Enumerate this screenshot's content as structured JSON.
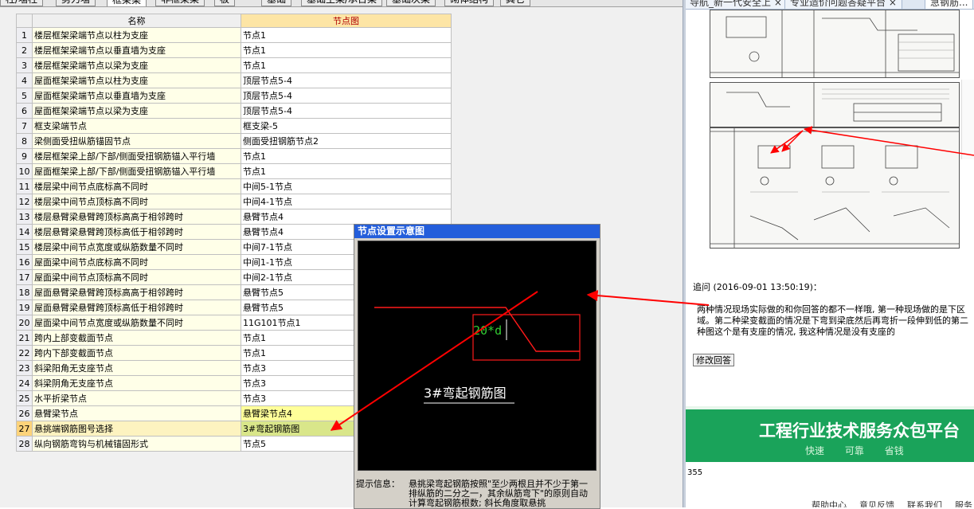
{
  "app": {
    "tabs": [
      "柱/墙柱",
      "剪力墙",
      "框架梁",
      "非框架梁",
      "板",
      "基础",
      "基础主梁/承台梁",
      "基础次梁",
      "砌体结构",
      "其它"
    ],
    "active_tab": 2,
    "table": {
      "headers": [
        "名称",
        "节点图"
      ],
      "rows": [
        {
          "num": "1",
          "name": "楼层框架梁端节点以柱为支座",
          "node": "节点1"
        },
        {
          "num": "2",
          "name": "楼层框架梁端节点以垂直墙为支座",
          "node": "节点1"
        },
        {
          "num": "3",
          "name": "楼层框架梁端节点以梁为支座",
          "node": "节点1"
        },
        {
          "num": "4",
          "name": "屋面框架梁端节点以柱为支座",
          "node": "顶层节点5-4"
        },
        {
          "num": "5",
          "name": "屋面框架梁端节点以垂直墙为支座",
          "node": "顶层节点5-4"
        },
        {
          "num": "6",
          "name": "屋面框架梁端节点以梁为支座",
          "node": "顶层节点5-4"
        },
        {
          "num": "7",
          "name": "框支梁端节点",
          "node": "框支梁-5"
        },
        {
          "num": "8",
          "name": "梁侧面受扭纵筋锚固节点",
          "node": "侧面受扭钢筋节点2"
        },
        {
          "num": "9",
          "name": "楼层框架梁上部/下部/侧面受扭钢筋锚入平行墙",
          "node": "节点1"
        },
        {
          "num": "10",
          "name": "屋面框架梁上部/下部/侧面受扭钢筋锚入平行墙",
          "node": "节点1"
        },
        {
          "num": "11",
          "name": "楼层梁中间节点底标高不同时",
          "node": "中间5-1节点"
        },
        {
          "num": "12",
          "name": "楼层梁中间节点顶标高不同时",
          "node": "中间4-1节点"
        },
        {
          "num": "13",
          "name": "楼层悬臂梁悬臂跨顶标高高于相邻跨时",
          "node": "悬臂节点4"
        },
        {
          "num": "14",
          "name": "楼层悬臂梁悬臂跨顶标高低于相邻跨时",
          "node": "悬臂节点4"
        },
        {
          "num": "15",
          "name": "楼层梁中间节点宽度或纵筋数量不同时",
          "node": "中间7-1节点"
        },
        {
          "num": "16",
          "name": "屋面梁中间节点底标高不同时",
          "node": "中间1-1节点"
        },
        {
          "num": "17",
          "name": "屋面梁中间节点顶标高不同时",
          "node": "中间2-1节点"
        },
        {
          "num": "18",
          "name": "屋面悬臂梁悬臂跨顶标高高于相邻跨时",
          "node": "悬臂节点5"
        },
        {
          "num": "19",
          "name": "屋面悬臂梁悬臂跨顶标高低于相邻跨时",
          "node": "悬臂节点5"
        },
        {
          "num": "20",
          "name": "屋面梁中间节点宽度或纵筋数量不同时",
          "node": "11G101节点1"
        },
        {
          "num": "21",
          "name": "跨内上部变截面节点",
          "node": "节点1"
        },
        {
          "num": "22",
          "name": "跨内下部变截面节点",
          "node": "节点1"
        },
        {
          "num": "23",
          "name": "斜梁阳角无支座节点",
          "node": "节点3"
        },
        {
          "num": "24",
          "name": "斜梁阴角无支座节点",
          "node": "节点3"
        },
        {
          "num": "25",
          "name": "水平折梁节点",
          "node": "节点3"
        },
        {
          "num": "26",
          "name": "悬臂梁节点",
          "node": "悬臂梁节点4"
        },
        {
          "num": "27",
          "name": "悬挑端钢筋图号选择",
          "node": "3#弯起钢筋图"
        },
        {
          "num": "28",
          "name": "纵向钢筋弯钩与机械锚固形式",
          "node": "节点5"
        }
      ],
      "selected_row": "27"
    },
    "dialog": {
      "title": "节点设置示意图",
      "diagram_formula": "20*d",
      "diagram_caption": "3#弯起钢筋图",
      "info_label": "提示信息：",
      "info_text": "悬挑梁弯起钢筋按照\"至少两根且并不少于第一排纵筋的二分之一，其余纵筋弯下\"的原则自动计算弯起钢筋根数; 斜长角度取悬挑"
    }
  },
  "browser": {
    "tabs": [
      "导航_新一代安全上 ×",
      "专业造价问题答疑平台 ×",
      "急钢筋..."
    ],
    "active_tab": 2,
    "post": {
      "meta": "追问 (2016-09-01 13:50:19)：",
      "body": "两种情况现场实际做的和你回答的都不一样哦, 第一种现场做的是下区域。第二种梁变截面的情况是下弯到梁底然后再弯折一段伸到低的第二种图这个是有支座的情况, 我这种情况是没有支座的",
      "edit_button": "修改回答"
    },
    "banner": {
      "main": "工程行业技术服务众包平台",
      "sub": [
        "快速",
        "可靠",
        "省钱"
      ]
    },
    "count": "355",
    "footer": [
      "帮助中心",
      "意见反馈",
      "联系我们",
      "服务"
    ]
  },
  "colors": {
    "arrow": "#ff0000",
    "dialog_title": "#245edb",
    "selected_row": "#d9e68a",
    "banner": "#1aa35a"
  }
}
